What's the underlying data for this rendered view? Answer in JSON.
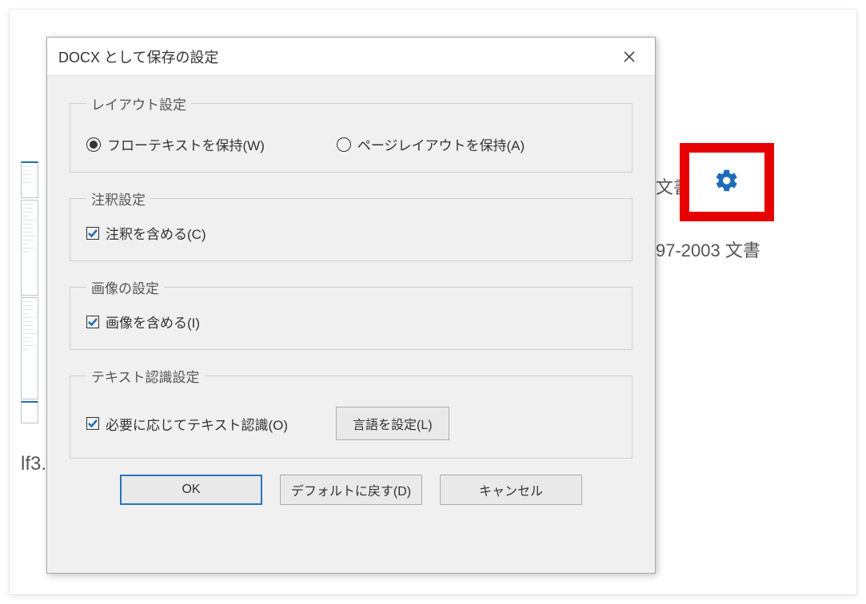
{
  "background": {
    "line1": "文書",
    "line2": "97-2003 文書",
    "line3": "lf3."
  },
  "dialog": {
    "title": "DOCX として保存の設定",
    "groups": {
      "layout": {
        "legend": "レイアウト設定",
        "radio_flow": "フローテキストを保持(W)",
        "radio_page": "ページレイアウトを保持(A)"
      },
      "comments": {
        "legend": "注釈設定",
        "check_include": "注釈を含める(C)"
      },
      "images": {
        "legend": "画像の設定",
        "check_include": "画像を含める(I)"
      },
      "ocr": {
        "legend": "テキスト認識設定",
        "check_recognize": "必要に応じてテキスト認識(O)",
        "btn_language": "言語を設定(L)"
      }
    },
    "buttons": {
      "ok": "OK",
      "defaults": "デフォルトに戻す(D)",
      "cancel": "キャンセル"
    }
  }
}
